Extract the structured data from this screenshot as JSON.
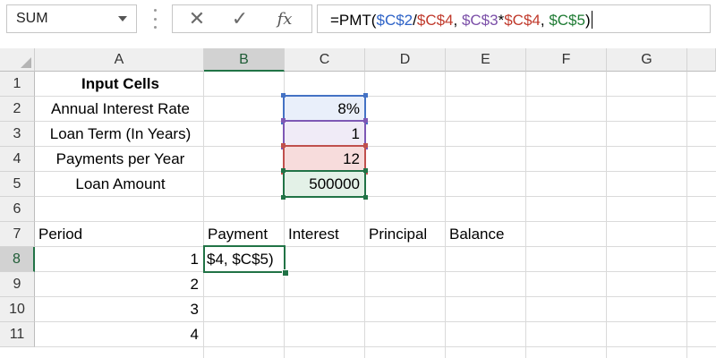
{
  "name_box": {
    "value": "SUM"
  },
  "formula_bar": {
    "cancel_icon": "✕",
    "enter_icon": "✓",
    "fx_label": "fx",
    "formula_parts": [
      {
        "text": "=PMT(",
        "color": "#000000"
      },
      {
        "text": "$C$2",
        "color": "#2e63c7"
      },
      {
        "text": "/",
        "color": "#000000"
      },
      {
        "text": "$C$4",
        "color": "#c0392b"
      },
      {
        "text": ", ",
        "color": "#000000"
      },
      {
        "text": "$C$3",
        "color": "#7b4fa8"
      },
      {
        "text": "*",
        "color": "#000000"
      },
      {
        "text": "$C$4",
        "color": "#c0392b"
      },
      {
        "text": ", ",
        "color": "#000000"
      },
      {
        "text": "$C$5",
        "color": "#1e7b33"
      },
      {
        "text": ")",
        "color": "#000000"
      }
    ]
  },
  "columns": [
    "A",
    "B",
    "C",
    "D",
    "E",
    "F",
    "G"
  ],
  "active_column": "B",
  "rows": [
    "1",
    "2",
    "3",
    "4",
    "5",
    "6",
    "7",
    "8",
    "9",
    "10",
    "11"
  ],
  "active_row": "8",
  "cells": {
    "A1": "Input Cells",
    "A2": "Annual Interest Rate",
    "A3": "Loan Term (In Years)",
    "A4": "Payments per Year",
    "A5": "Loan Amount",
    "C2": "8%",
    "C3": "1",
    "C4": "12",
    "C5": "500000",
    "A7": "Period",
    "B7": "Payment",
    "C7": "Interest",
    "D7": "Principal",
    "E7": "Balance",
    "A8": "1",
    "A9": "2",
    "A10": "3",
    "A11": "4",
    "B8": "$4, $C$5)"
  },
  "reference_colors": {
    "C2": {
      "border": "#4472c4",
      "fill": "#e9effa"
    },
    "C3": {
      "border": "#7e58b5",
      "fill": "#f0ebf7"
    },
    "C4": {
      "border": "#c0504d",
      "fill": "#f7dcdc"
    },
    "C5": {
      "border": "#217346",
      "fill": "#e3f1e7"
    }
  },
  "selection_color": "#217346"
}
